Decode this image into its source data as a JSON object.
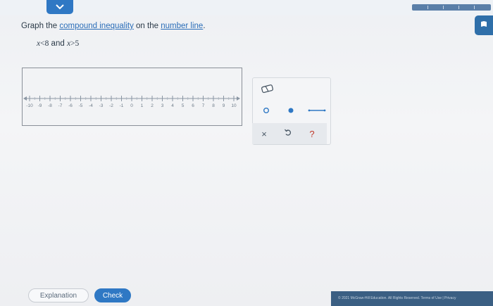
{
  "header": {
    "collapse_icon": "chevron-down-icon",
    "progress_segments": 5,
    "side_icon": "book-icon"
  },
  "question": {
    "prompt_start": "Graph the ",
    "link_1": "compound inequality",
    "prompt_mid": " on the ",
    "link_2": "number line",
    "prompt_end": ".",
    "lhs_1": "x",
    "op_1": "<",
    "val_1": "8",
    "and_word": " and ",
    "lhs_2": "x",
    "op_2": ">",
    "val_2": "5"
  },
  "number_line": {
    "min": -10,
    "max": 10,
    "tick_labels": [
      "-10",
      "-9",
      "-8",
      "-7",
      "-6",
      "-5",
      "-4",
      "-3",
      "-2",
      "-1",
      "0",
      "1",
      "2",
      "3",
      "4",
      "5",
      "6",
      "7",
      "8",
      "9",
      "10"
    ]
  },
  "tools": {
    "eraser": "eraser-icon",
    "open_point": "open-circle-icon",
    "closed_point": "closed-circle-icon",
    "segment": "segment-icon",
    "clear": "×",
    "undo": "undo-icon",
    "help": "?"
  },
  "buttons": {
    "explanation": "Explanation",
    "check": "Check"
  },
  "footer": {
    "text": "© 2021 McGraw-Hill Education. All Rights Reserved.   Terms of Use   |   Privacy"
  },
  "colors": {
    "accent": "#2f78c4",
    "text": "#2b3a48",
    "link": "#2a6db8"
  }
}
